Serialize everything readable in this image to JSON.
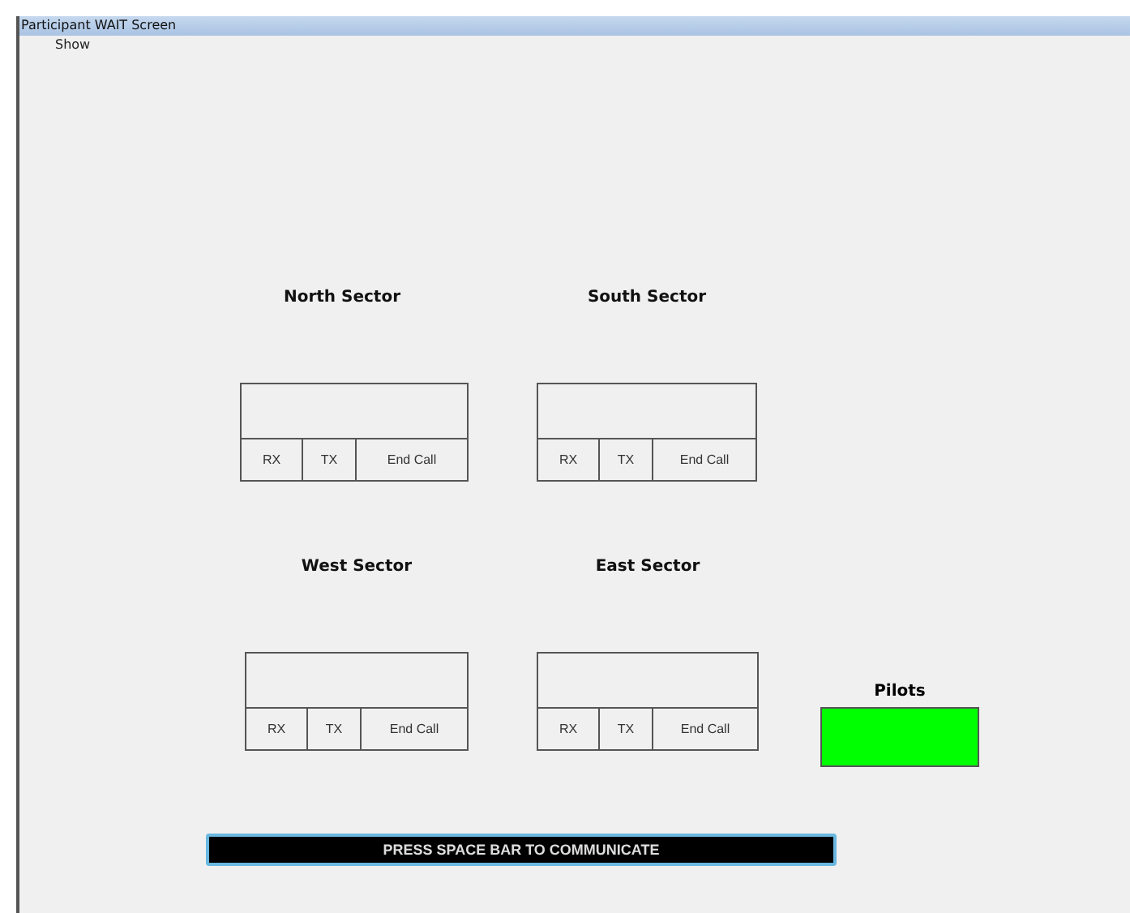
{
  "window": {
    "title": "Participant WAIT Screen"
  },
  "menu": [
    "Show"
  ],
  "sectors": [
    {
      "name": "North Sector",
      "buttons": [
        "RX",
        "TX",
        "End Call"
      ]
    },
    {
      "name": "South Sector",
      "buttons": [
        "RX",
        "TX",
        "End Call"
      ]
    },
    {
      "name": "West Sector",
      "buttons": [
        "RX",
        "TX",
        "End Call"
      ]
    },
    {
      "name": "East Sector",
      "buttons": [
        "RX",
        "TX",
        "End Call"
      ]
    }
  ],
  "pilots": {
    "label": "Pilots",
    "color": "#00ff00"
  },
  "prompt": "PRESS SPACE BAR TO COMMUNICATE"
}
